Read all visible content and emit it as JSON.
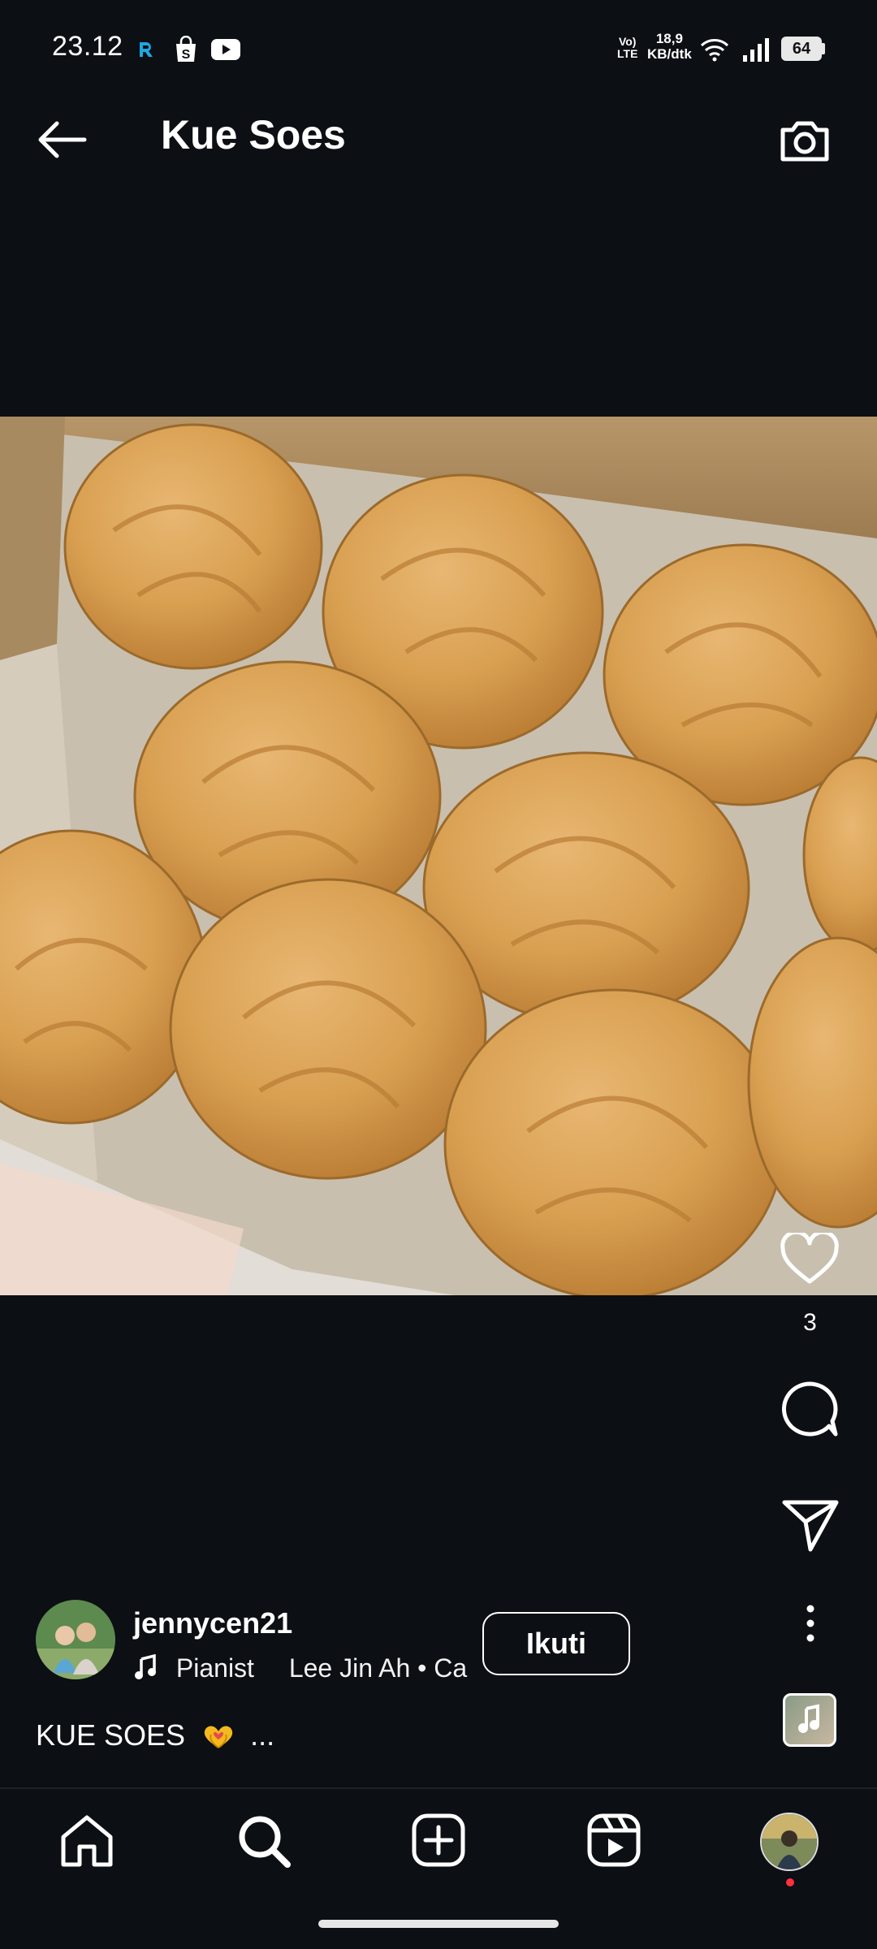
{
  "status_bar": {
    "time": "23.12",
    "network_speed_value": "18,9",
    "network_speed_unit": "KB/dtk",
    "volte_top": "Vo)",
    "volte_bottom": "LTE",
    "battery": "64",
    "left_icons": [
      "app-notification-icon",
      "shopping-bag-icon",
      "youtube-icon"
    ],
    "right_icons": [
      "wifi-icon",
      "signal-icon",
      "battery-icon"
    ]
  },
  "header": {
    "title": "Kue Soes",
    "back_icon": "arrow-left-icon",
    "camera_icon": "camera-icon"
  },
  "post": {
    "like_count": "3",
    "author": {
      "username": "jennycen21",
      "music_title": "Pianist",
      "music_artist": "Lee Jin Ah • Ca",
      "follow_label": "Ikuti"
    },
    "caption": "KUE SOES",
    "caption_more": "..."
  },
  "nav": {
    "items": [
      "home-icon",
      "search-icon",
      "create-icon",
      "reels-icon",
      "profile-avatar"
    ]
  },
  "colors": {
    "background": "#0c0f14",
    "text": "#ffffff",
    "notification_dot": "#ff3040"
  }
}
